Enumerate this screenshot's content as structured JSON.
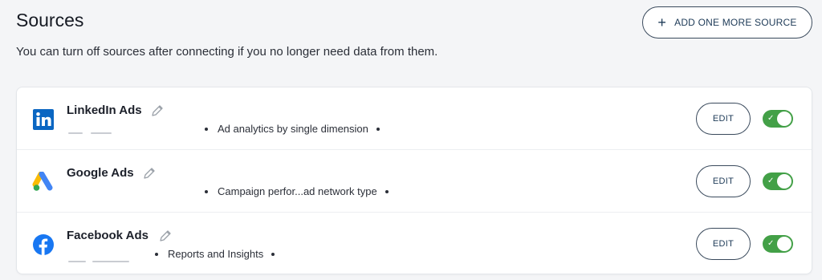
{
  "header": {
    "title": "Sources",
    "subtitle": "You can turn off sources after connecting if you no longer need data from them.",
    "add_button": {
      "icon": "plus-icon",
      "label": "ADD ONE MORE SOURCE"
    }
  },
  "sources": [
    {
      "name": "LinkedIn Ads",
      "logo": "linkedin-logo",
      "description": "Ad analytics by single dimension",
      "edit_label": "EDIT",
      "enabled": true
    },
    {
      "name": "Google Ads",
      "logo": "google-ads-logo",
      "description": "Campaign perfor...ad network type",
      "edit_label": "EDIT",
      "enabled": true
    },
    {
      "name": "Facebook Ads",
      "logo": "facebook-logo",
      "description": "Reports and Insights",
      "edit_label": "EDIT",
      "enabled": true
    }
  ],
  "colors": {
    "toggle_on": "#43a047",
    "linkedin": "#0a66c2",
    "facebook": "#1877f2",
    "button_border": "#3a4a5c"
  }
}
